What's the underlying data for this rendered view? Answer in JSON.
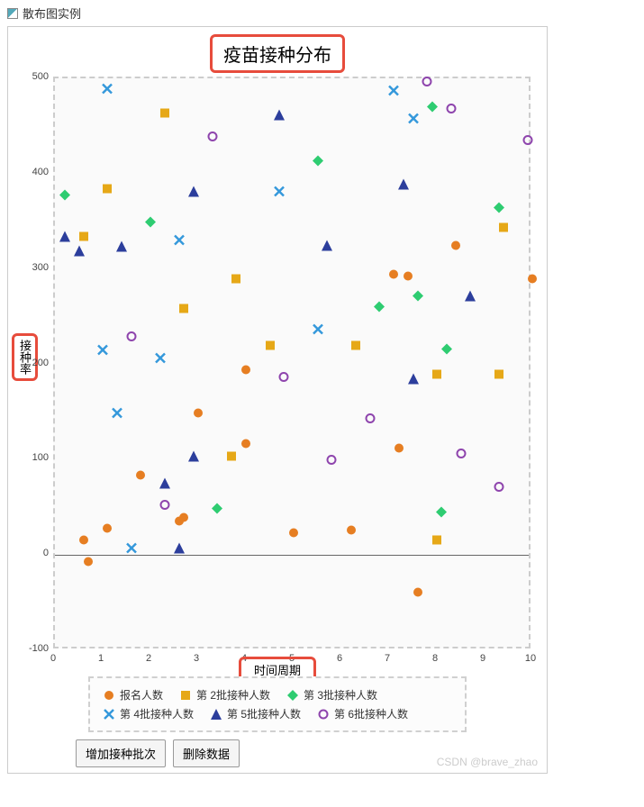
{
  "header": {
    "label": "散布图实例"
  },
  "chart_data": {
    "type": "scatter",
    "title": "疫苗接种分布",
    "xlabel": "时间周期",
    "ylabel": "接种率",
    "xlim": [
      0,
      10
    ],
    "ylim": [
      -100,
      500
    ],
    "x_ticks": [
      0,
      1,
      2,
      3,
      4,
      5,
      6,
      7,
      8,
      9,
      10
    ],
    "y_ticks": [
      -100,
      0,
      100,
      200,
      300,
      400,
      500
    ],
    "series": [
      {
        "name": "报名人数",
        "marker": "circle-filled",
        "color": "#e67e22",
        "points": [
          [
            0.6,
            14
          ],
          [
            0.7,
            -8
          ],
          [
            1.1,
            27
          ],
          [
            1.8,
            82
          ],
          [
            2.6,
            34
          ],
          [
            2.7,
            38
          ],
          [
            3.0,
            148
          ],
          [
            4.0,
            115
          ],
          [
            4.0,
            193
          ],
          [
            5.0,
            22
          ],
          [
            6.2,
            25
          ],
          [
            7.1,
            293
          ],
          [
            7.2,
            111
          ],
          [
            7.4,
            291
          ],
          [
            7.6,
            -40
          ],
          [
            8.4,
            323
          ],
          [
            10.0,
            288
          ]
        ]
      },
      {
        "name": "第 2批接种人数",
        "marker": "square-filled",
        "color": "#e6a817",
        "points": [
          [
            0.6,
            333
          ],
          [
            1.1,
            383
          ],
          [
            2.3,
            462
          ],
          [
            2.7,
            257
          ],
          [
            3.7,
            102
          ],
          [
            3.8,
            288
          ],
          [
            4.5,
            218
          ],
          [
            6.3,
            218
          ],
          [
            8.0,
            188
          ],
          [
            8.0,
            14
          ],
          [
            9.3,
            188
          ],
          [
            9.4,
            342
          ]
        ]
      },
      {
        "name": "第 3批接种人数",
        "marker": "diamond-filled",
        "color": "#2ecc71",
        "points": [
          [
            0.2,
            376
          ],
          [
            2.0,
            348
          ],
          [
            3.4,
            47
          ],
          [
            5.5,
            412
          ],
          [
            6.8,
            259
          ],
          [
            7.6,
            270
          ],
          [
            7.9,
            469
          ],
          [
            8.1,
            44
          ],
          [
            8.2,
            215
          ],
          [
            9.3,
            363
          ]
        ]
      },
      {
        "name": "第 4批接种人数",
        "marker": "x-mark",
        "color": "#3498db",
        "points": [
          [
            1.1,
            488
          ],
          [
            1.0,
            214
          ],
          [
            1.3,
            148
          ],
          [
            1.6,
            6
          ],
          [
            2.2,
            205
          ],
          [
            2.6,
            329
          ],
          [
            4.7,
            380
          ],
          [
            5.5,
            235
          ],
          [
            7.1,
            486
          ],
          [
            7.5,
            457
          ]
        ]
      },
      {
        "name": "第 5批接种人数",
        "marker": "triangle-filled",
        "color": "#2c3e9c",
        "points": [
          [
            0.2,
            333
          ],
          [
            0.5,
            318
          ],
          [
            1.4,
            322
          ],
          [
            2.3,
            74
          ],
          [
            2.6,
            6
          ],
          [
            2.9,
            102
          ],
          [
            2.9,
            380
          ],
          [
            4.7,
            460
          ],
          [
            5.7,
            323
          ],
          [
            7.3,
            388
          ],
          [
            7.5,
            183
          ],
          [
            8.7,
            270
          ]
        ]
      },
      {
        "name": "第 6批接种人数",
        "marker": "circle-open",
        "color": "#8e44ad",
        "points": [
          [
            1.6,
            228
          ],
          [
            2.3,
            51
          ],
          [
            3.3,
            438
          ],
          [
            4.8,
            185
          ],
          [
            5.8,
            98
          ],
          [
            6.6,
            142
          ],
          [
            7.8,
            495
          ],
          [
            8.3,
            467
          ],
          [
            8.5,
            105
          ],
          [
            9.3,
            70
          ],
          [
            9.9,
            434
          ]
        ]
      }
    ]
  },
  "legend": {
    "items": [
      "报名人数",
      "第 2批接种人数",
      "第 3批接种人数",
      "第 4批接种人数",
      "第 5批接种人数",
      "第 6批接种人数"
    ]
  },
  "buttons": {
    "add": "增加接种批次",
    "delete": "删除数据"
  },
  "watermark": "CSDN @brave_zhao"
}
